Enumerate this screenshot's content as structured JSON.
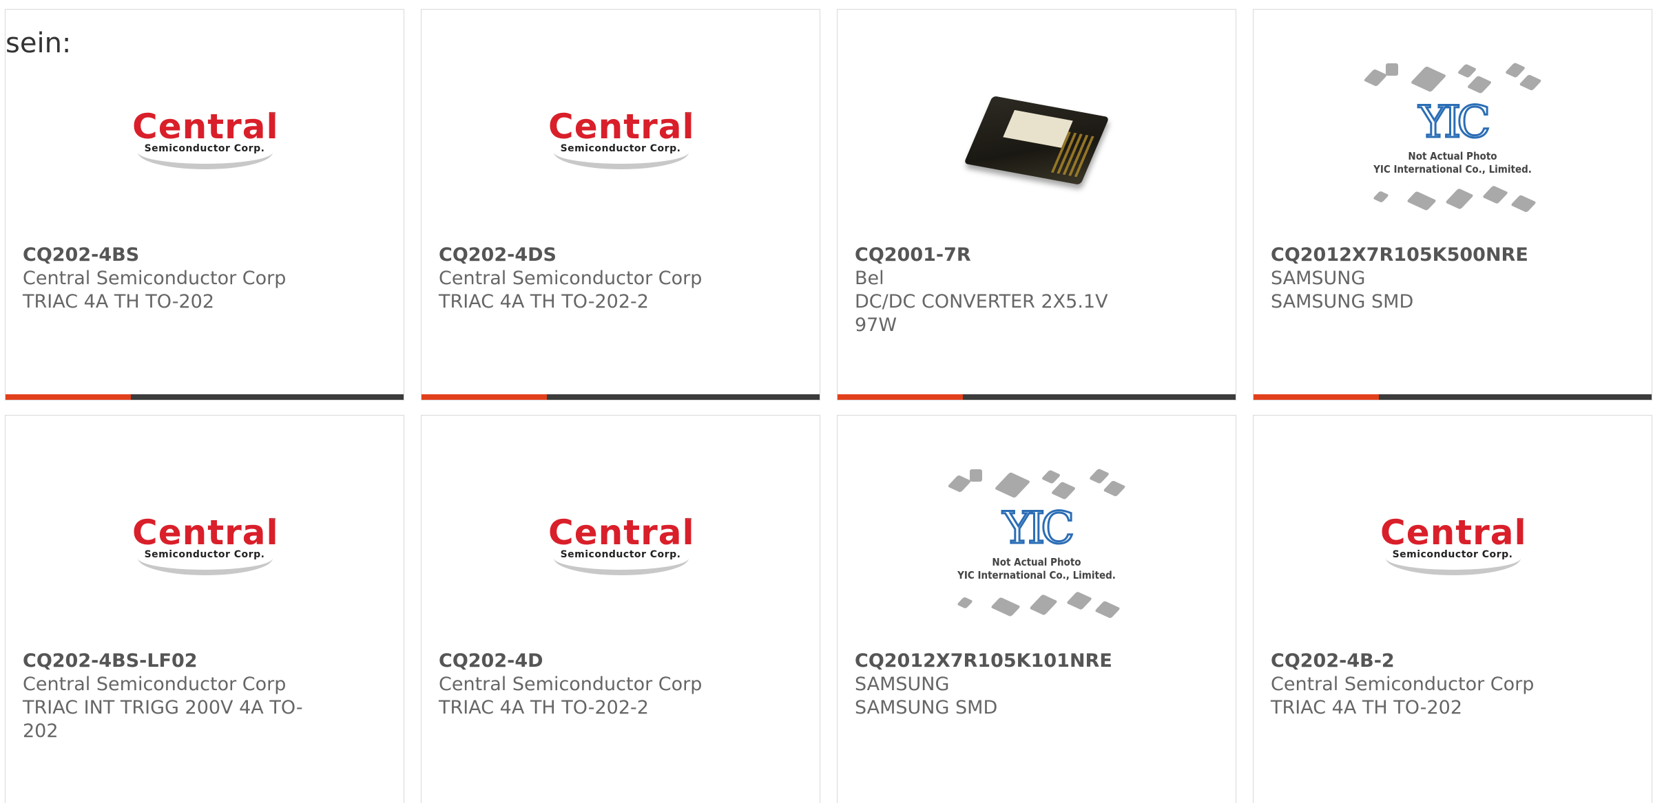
{
  "lead_text": "sein:",
  "products": [
    {
      "part_number": "CQ202-4BS",
      "manufacturer": "Central Semiconductor Corp",
      "description": "TRIAC 4A TH TO-202",
      "image": "central-semiconductor-logo"
    },
    {
      "part_number": "CQ202-4DS",
      "manufacturer": "Central Semiconductor Corp",
      "description": "TRIAC 4A TH TO-202-2",
      "image": "central-semiconductor-logo"
    },
    {
      "part_number": "CQ2001-7R",
      "manufacturer": "Bel",
      "description": "DC/DC CONVERTER 2X5.1V 97W",
      "image": "dc-dc-converter-photo"
    },
    {
      "part_number": "CQ2012X7R105K500NRE",
      "manufacturer": "SAMSUNG",
      "description": "SAMSUNG SMD",
      "image": "yic-placeholder"
    },
    {
      "part_number": "CQ202-4BS-LF02",
      "manufacturer": "Central Semiconductor Corp",
      "description": "TRIAC INT TRIGG 200V 4A TO-202",
      "image": "central-semiconductor-logo"
    },
    {
      "part_number": "CQ202-4D",
      "manufacturer": "Central Semiconductor Corp",
      "description": "TRIAC 4A TH TO-202-2",
      "image": "central-semiconductor-logo"
    },
    {
      "part_number": "CQ2012X7R105K101NRE",
      "manufacturer": "SAMSUNG",
      "description": "SAMSUNG SMD",
      "image": "yic-placeholder"
    },
    {
      "part_number": "CQ202-4B-2",
      "manufacturer": "Central Semiconductor Corp",
      "description": "TRIAC 4A TH TO-202",
      "image": "central-semiconductor-logo"
    }
  ],
  "logos": {
    "central_wordmark": "Central",
    "central_subline": "Semiconductor Corp.",
    "central_tm": "™",
    "yic_mark": "YIC",
    "yic_caption_line1": "Not Actual Photo",
    "yic_caption_line2": "YIC International Co., Limited."
  },
  "colors": {
    "accent": "#e2401c",
    "bar": "#3c3c3c",
    "central_red": "#d91f2a",
    "yic_blue": "#2a6db5"
  }
}
